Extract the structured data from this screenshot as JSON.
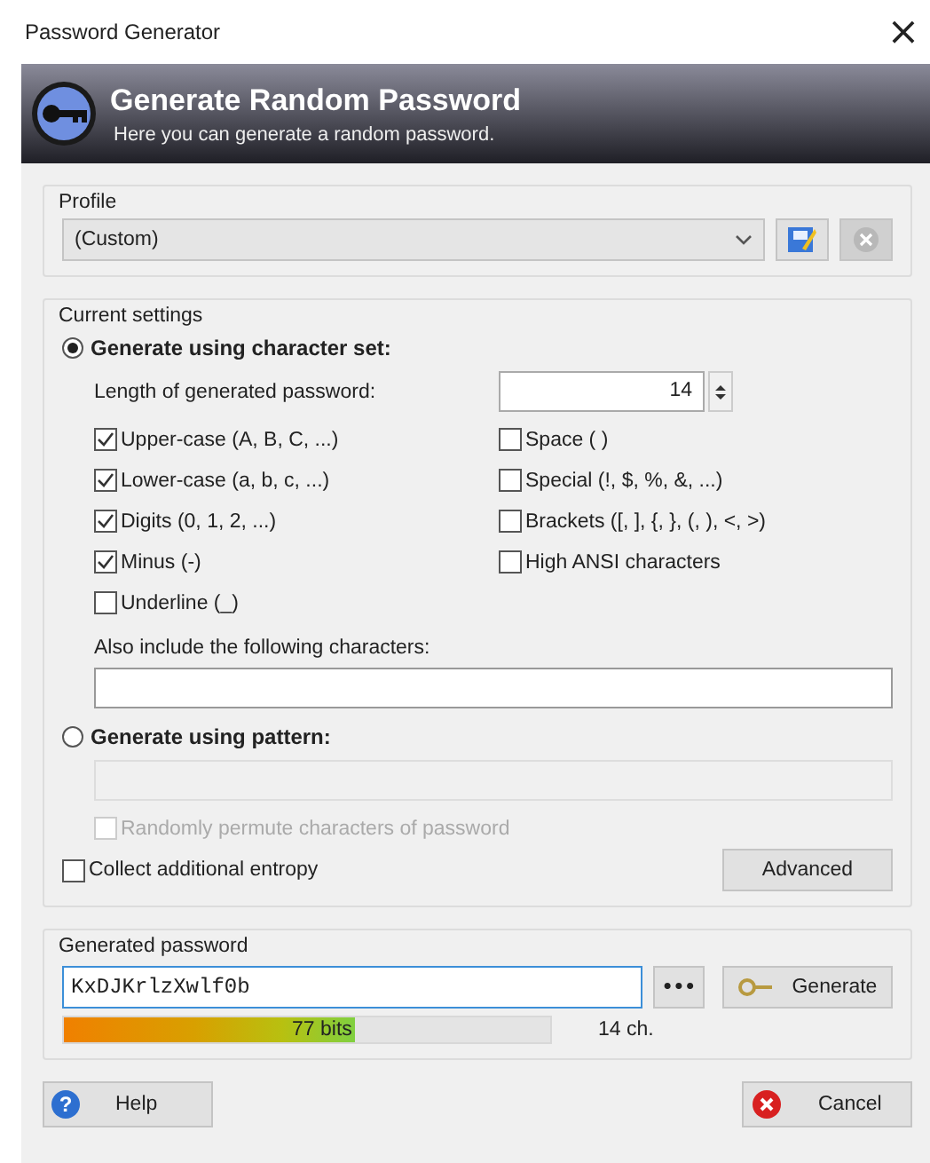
{
  "window": {
    "title": "Password Generator",
    "close": "×"
  },
  "banner": {
    "title": "Generate Random Password",
    "subtitle": "Here you can generate a random password."
  },
  "profile": {
    "label": "Profile",
    "value": "(Custom)",
    "delete_disabled": true
  },
  "settings": {
    "label": "Current settings",
    "modes": [
      {
        "label": "Generate using character set:",
        "selected": true
      },
      {
        "label": "Generate using pattern:",
        "selected": false
      }
    ],
    "length_label": "Length of generated password:",
    "length": "14",
    "left_options": [
      {
        "label": "Upper-case (A, B, C, ...)",
        "checked": true
      },
      {
        "label": "Lower-case (a, b, c, ...)",
        "checked": true
      },
      {
        "label": "Digits (0, 1, 2, ...)",
        "checked": true
      },
      {
        "label": "Minus (-)",
        "checked": true
      },
      {
        "label": "Underline (_)",
        "checked": false
      }
    ],
    "right_options": [
      {
        "label": "Space ( )",
        "checked": false
      },
      {
        "label": "Special (!, $, %, &, ...)",
        "checked": false
      },
      {
        "label": "Brackets ([, ], {, }, (, ), <, >)",
        "checked": false
      },
      {
        "label": "High ANSI characters",
        "checked": false
      }
    ],
    "include_label": "Also include the following characters:",
    "permute": {
      "label": "Randomly permute characters of password",
      "checked": false,
      "disabled": true
    },
    "entropy": {
      "label": "Collect additional entropy",
      "checked": false
    },
    "advanced": "Advanced"
  },
  "generated": {
    "label": "Generated password",
    "value": "KxDJKrlzXwlf0b",
    "reveal": "•••",
    "generate": "Generate",
    "level": 0.6,
    "bits": "77 bits",
    "chars": "14 ch."
  },
  "buttons": {
    "help_icon": "?",
    "help": "Help",
    "cancel": "Cancel"
  }
}
